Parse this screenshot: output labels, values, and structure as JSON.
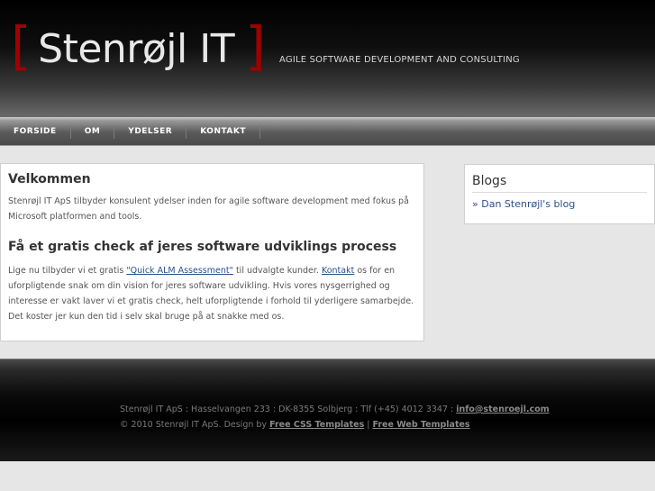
{
  "header": {
    "bracket_left": "[",
    "logo_text": "Stenrøjl IT",
    "bracket_right": "]",
    "tagline": "AGILE SOFTWARE DEVELOPMENT AND CONSULTING"
  },
  "nav": {
    "items": [
      {
        "label": "FORSIDE"
      },
      {
        "label": "OM"
      },
      {
        "label": "YDELSER"
      },
      {
        "label": "KONTAKT"
      }
    ]
  },
  "main": {
    "title": "Velkommen",
    "intro": "Stenrøjl IT ApS tilbyder konsulent ydelser inden for agile software development med fokus på Microsoft platformen and tools.",
    "subtitle": "Få et gratis check af jeres software udviklings process",
    "body_part1": "Lige nu tilbyder vi et gratis ",
    "link_alm": "\"Quick ALM Assessment\"",
    "body_part2": " til udvalgte kunder. ",
    "link_kontakt": "Kontakt",
    "body_part3": " os for en uforpligtende snak om din vision for jeres software udvikling. Hvis vores nysgerrighed og interesse er vakt laver vi et gratis check, helt uforpligtende i forhold til yderligere samarbejde. Det koster jer kun den tid i selv skal bruge på at snakke med os."
  },
  "sidebar": {
    "title": "Blogs",
    "blog_link": "» Dan Stenrøjl's blog"
  },
  "footer": {
    "address": "Stenrøjl IT ApS : Hasselvangen 233 : DK-8355 Solbjerg : Tlf (+45) 4012 3347 : ",
    "email": "info@stenroejl.com",
    "copyright": "© 2010 Stenrøjl IT ApS. Design by ",
    "link_css": "Free CSS Templates",
    "separator": " | ",
    "link_web": "Free Web Templates"
  },
  "colors": {
    "bracket": "#a00000",
    "link": "#2a4f8a",
    "background": "#e6e6e6"
  }
}
